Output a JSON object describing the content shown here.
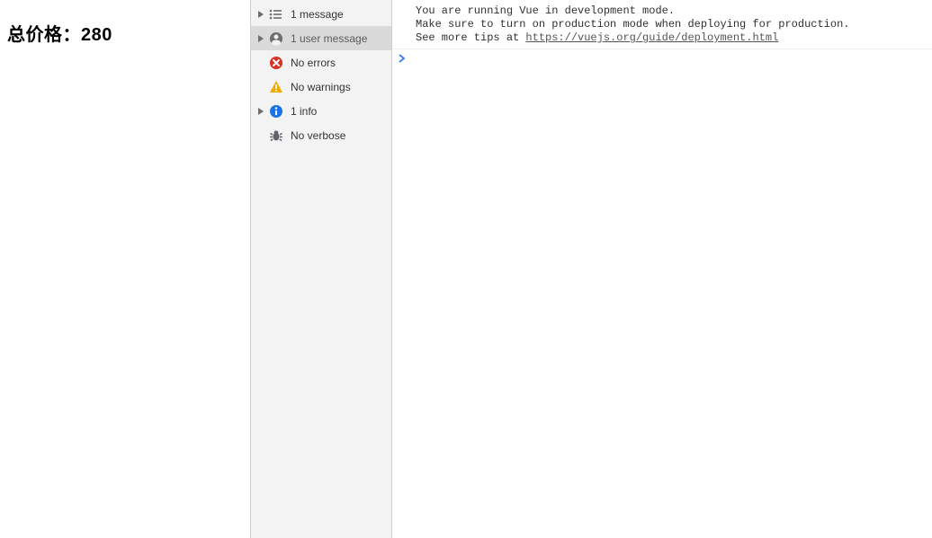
{
  "left": {
    "price_text": "总价格：280"
  },
  "sidebar": {
    "items": [
      {
        "label": "1 message"
      },
      {
        "label": "1 user message"
      },
      {
        "label": "No errors"
      },
      {
        "label": "No warnings"
      },
      {
        "label": "1 info"
      },
      {
        "label": "No verbose"
      }
    ]
  },
  "console": {
    "line1": "You are running Vue in development mode.",
    "line2": "Make sure to turn on production mode when deploying for production.",
    "line3_prefix": "See more tips at ",
    "line3_link": "https://vuejs.org/guide/deployment.html"
  }
}
